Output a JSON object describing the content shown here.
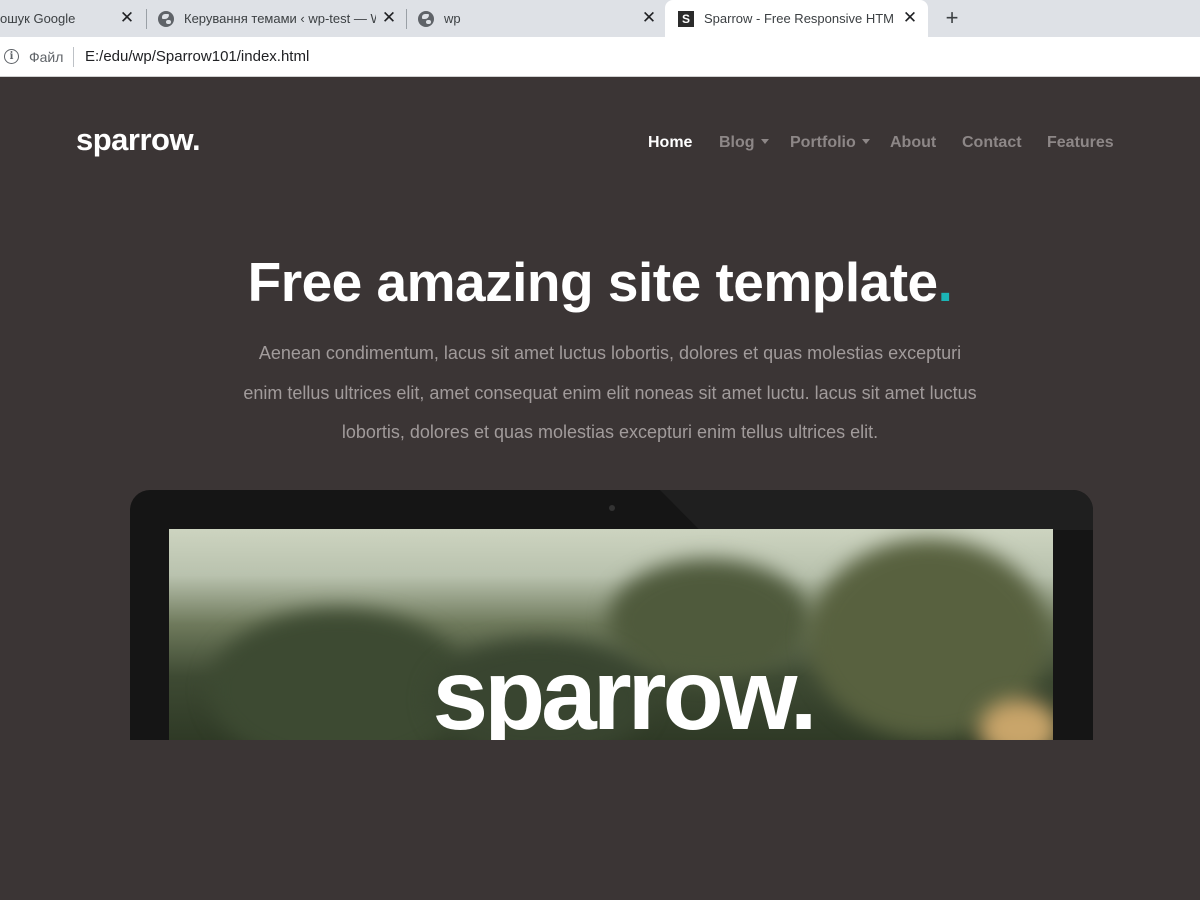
{
  "browser": {
    "tabs": [
      {
        "title": "ошук Google",
        "active": false
      },
      {
        "title": "Керування темами ‹ wp-test — W",
        "active": false
      },
      {
        "title": "wp",
        "active": false
      },
      {
        "title": "Sparrow - Free Responsive HTML",
        "active": true
      }
    ],
    "close_glyph": "✕",
    "new_tab_glyph": "+",
    "address": {
      "file_label": "Файл",
      "url": "E:/edu/wp/Sparrow101/index.html"
    }
  },
  "site": {
    "logo": "sparrow.",
    "nav": [
      {
        "label": "Home",
        "active": true,
        "dropdown": false
      },
      {
        "label": "Blog",
        "active": false,
        "dropdown": true
      },
      {
        "label": "Portfolio",
        "active": false,
        "dropdown": true
      },
      {
        "label": "About",
        "active": false,
        "dropdown": false
      },
      {
        "label": "Contact",
        "active": false,
        "dropdown": false
      },
      {
        "label": "Features",
        "active": false,
        "dropdown": false
      }
    ],
    "hero": {
      "title": "Free amazing site template",
      "title_dot": ".",
      "accent_color": "#1bb5b6",
      "text_lines": [
        "Aenean condimentum, lacus sit amet luctus lobortis, dolores et quas molestias excepturi",
        "enim tellus ultrices elit, amet consequat enim elit noneas sit amet luctu. lacus sit amet luctus",
        "lobortis, dolores et quas molestias excepturi enim tellus ultrices elit."
      ]
    },
    "screen_logo": "sparrow."
  }
}
